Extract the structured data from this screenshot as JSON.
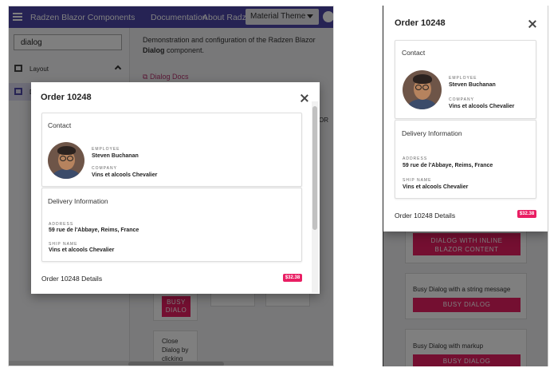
{
  "app": {
    "title": "Radzen Blazor Components",
    "nav": [
      "Documentation",
      "About Radzen"
    ],
    "theme": "Material Theme"
  },
  "sidebar": {
    "search_value": "dialog",
    "items": [
      {
        "label": "Layout"
      },
      {
        "label": "D"
      }
    ]
  },
  "content": {
    "desc_prefix": "Demonstration and configuration of the Radzen Blazor",
    "desc_bold": "Dialog",
    "desc_suffix": "component.",
    "docs_link": "Dialog Docs",
    "fragments": {
      "or": "OR",
      "busy1": "BUSY",
      "busy2": "DIALO",
      "close_text": [
        "Close",
        "Dialog by",
        "clicking"
      ]
    }
  },
  "dialog": {
    "title": "Order 10248",
    "contact_header": "Contact",
    "employee_caption": "Employee",
    "employee": "Steven Buchanan",
    "company_caption": "Company",
    "company": "Vins et alcools Chevalier",
    "delivery_header": "Delivery Information",
    "address_caption": "Address",
    "address": "59 rue de l'Abbaye, Reims, France",
    "ship_caption": "Ship Name",
    "ship_name": "Vins et alcools Chevalier",
    "footer_label": "Order 10248 Details",
    "amount": "$32.38"
  },
  "right_bg": {
    "inline_button": [
      "DIALOG WITH INLINE",
      "BLAZOR CONTENT"
    ],
    "busy_string_label": "Busy Dialog with a string message",
    "busy_button": "BUSY DIALOG",
    "busy_markup_label": "Busy Dialog with markup",
    "busy_button2": "BUSY DIALOG"
  },
  "colors": {
    "primary": "#4c46a8",
    "accent": "#e91e63"
  }
}
